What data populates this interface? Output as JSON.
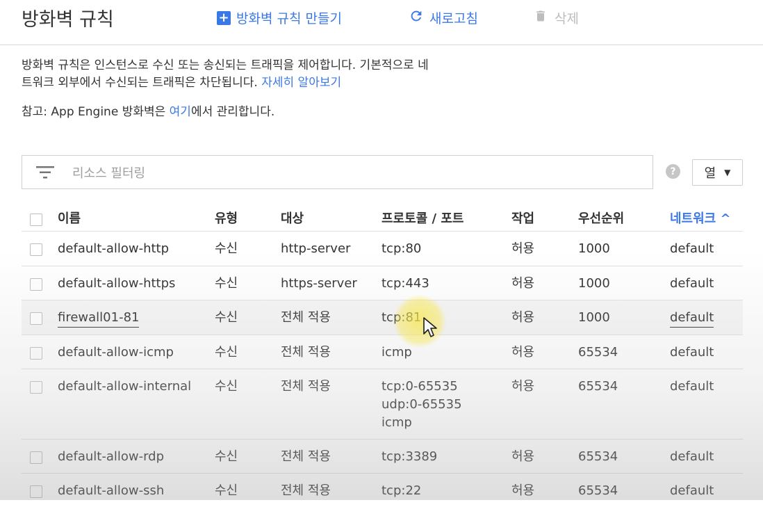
{
  "header": {
    "title": "방화벽 규칙",
    "create_label": "방화벽 규칙 만들기",
    "refresh_label": "새로고침",
    "delete_label": "삭제"
  },
  "description": {
    "line1": "방화벽 규칙은 인스턴스로 수신 또는 송신되는 트래픽을 제어합니다. 기본적으로 네",
    "line2": "트워크 외부에서 수신되는 트래픽은 차단됩니다.",
    "learn_more": "자세히 알아보기"
  },
  "note": {
    "prefix": "참고: App Engine 방화벽은 ",
    "link": "여기",
    "suffix": "에서 관리합니다."
  },
  "filter": {
    "placeholder": "리소스 필터링"
  },
  "columns_button": "열",
  "table": {
    "headers": {
      "name": "이름",
      "type": "유형",
      "target": "대상",
      "protocol": "프로토콜 / 포트",
      "action": "작업",
      "priority": "우선순위",
      "network": "네트워크 ^"
    },
    "rows": [
      {
        "name": "default-allow-http",
        "type": "수신",
        "target": "http-server",
        "protocol": "tcp:80",
        "action": "허용",
        "priority": "1000",
        "network": "default"
      },
      {
        "name": "default-allow-https",
        "type": "수신",
        "target": "https-server",
        "protocol": "tcp:443",
        "action": "허용",
        "priority": "1000",
        "network": "default"
      },
      {
        "name": "firewall01-81",
        "type": "수신",
        "target": "전체 적용",
        "protocol": "tcp:81",
        "action": "허용",
        "priority": "1000",
        "network": "default"
      },
      {
        "name": "default-allow-icmp",
        "type": "수신",
        "target": "전체 적용",
        "protocol": "icmp",
        "action": "허용",
        "priority": "65534",
        "network": "default"
      },
      {
        "name": "default-allow-internal",
        "type": "수신",
        "target": "전체 적용",
        "protocol": "tcp:0-65535\nudp:0-65535\nicmp",
        "action": "허용",
        "priority": "65534",
        "network": "default"
      },
      {
        "name": "default-allow-rdp",
        "type": "수신",
        "target": "전체 적용",
        "protocol": "tcp:3389",
        "action": "허용",
        "priority": "65534",
        "network": "default"
      },
      {
        "name": "default-allow-ssh",
        "type": "수신",
        "target": "전체 적용",
        "protocol": "tcp:22",
        "action": "허용",
        "priority": "65534",
        "network": "default"
      }
    ]
  },
  "colors": {
    "accent": "#3b78e7",
    "disabled": "#bdbdbd",
    "highlight": "#f5f5f5"
  },
  "icons": [
    "plus-icon",
    "refresh-icon",
    "trash-icon",
    "filter-icon",
    "help-icon",
    "caret-down-icon",
    "mouse-cursor-icon"
  ]
}
